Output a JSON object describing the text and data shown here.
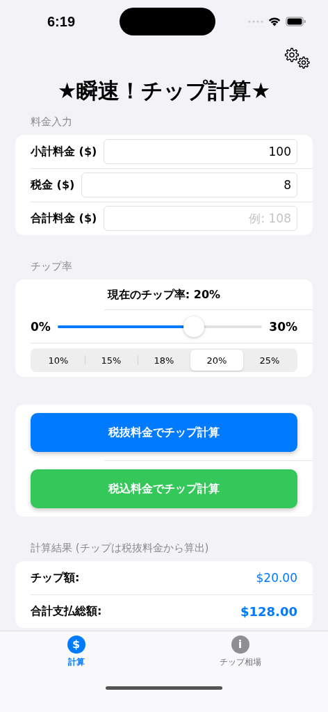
{
  "status_bar": {
    "time": "6:19"
  },
  "title": "★瞬速！チップ計算★",
  "bill_section": {
    "header": "料金入力",
    "fields": [
      {
        "label": "小計料金 ($)",
        "value": "100"
      },
      {
        "label": "税金 ($)",
        "value": "8"
      },
      {
        "label": "合計料金 ($)",
        "placeholder": "例: 108"
      }
    ]
  },
  "tip_section": {
    "header": "チップ率",
    "current": "現在のチップ率: 20%",
    "min_label": "0%",
    "max_label": "30%",
    "slider": {
      "level": 0.667
    },
    "presets": [
      {
        "label": "10%",
        "selected": false
      },
      {
        "label": "15%",
        "selected": false
      },
      {
        "label": "18%",
        "selected": false
      },
      {
        "label": "20%",
        "selected": true
      },
      {
        "label": "25%",
        "selected": false
      }
    ]
  },
  "actions": [
    {
      "label": "税抜料金でチップ計算",
      "kind": "primary"
    },
    {
      "label": "税込料金でチップ計算",
      "kind": "success"
    }
  ],
  "results": {
    "header": "計算結果 (チップは税抜料金から算出)",
    "rows": [
      {
        "label": "チップ額:",
        "value": "$20.00",
        "emphasis": false
      },
      {
        "label": "合計支払総額:",
        "value": "$128.00",
        "emphasis": true
      }
    ]
  },
  "tab_bar": [
    {
      "label": "計算",
      "icon": "$",
      "selected": true
    },
    {
      "label": "チップ相場",
      "icon": "i",
      "selected": false
    }
  ]
}
